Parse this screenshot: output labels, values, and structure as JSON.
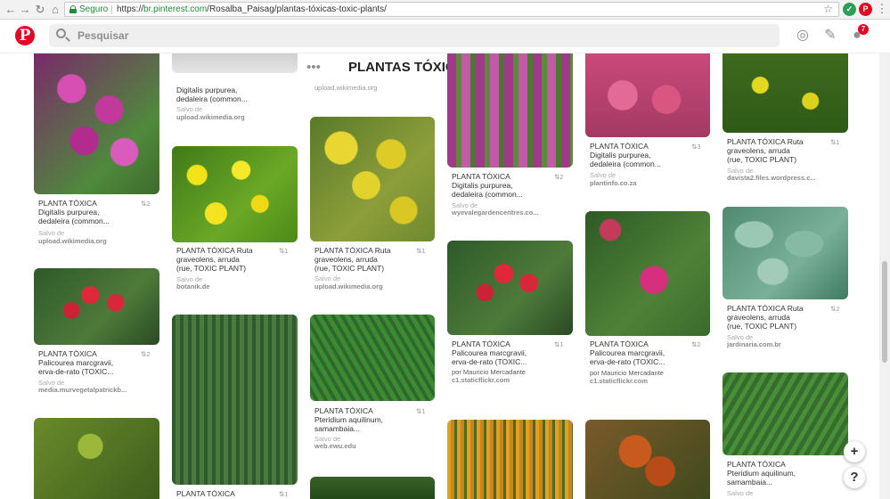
{
  "browser": {
    "secure_label": "Seguro",
    "url_scheme": "https://",
    "url_host": "br.pinterest.com",
    "url_path": "/Rosalba_Paisag/plantas-tóxicas-toxic-plants/"
  },
  "header": {
    "logo": "P",
    "search_placeholder": "Pesquisar",
    "notification_count": "7"
  },
  "board": {
    "title": "PLANTAS TÓXICAS - TOXIC ..."
  },
  "pins": [
    {
      "id": "c1a",
      "title_lines": [
        "PLANTA TÓXICA",
        "Digitalis purpurea,",
        "dedaleira (common..."
      ],
      "count": "2",
      "from": "Salvo de",
      "source": "upload.wikimedia.org"
    },
    {
      "id": "c1b",
      "title_lines": [
        "PLANTA TÓXICA",
        "Palicourea marcgravii,",
        "erva-de-rato (TOXIC..."
      ],
      "count": "2",
      "from": "Salvo de",
      "source": "media.murvegetalpatrickb..."
    },
    {
      "id": "c2a",
      "title_lines": [
        "Digitalis purpurea,",
        "dedaleira (common..."
      ],
      "count": "",
      "from": "Salvo de",
      "source": "upload.wikimedia.org"
    },
    {
      "id": "c2b",
      "title_lines": [
        "PLANTA TÓXICA Ruta",
        "graveolens, arruda",
        "(rue, TOXIC PLANT)"
      ],
      "count": "1",
      "from": "Salvo de",
      "source": "botanik.de"
    },
    {
      "id": "c2c",
      "title_lines": [
        "PLANTA TÓXICA"
      ],
      "count": "1",
      "from": "",
      "source": ""
    },
    {
      "id": "c3a",
      "title_lines": [],
      "count": "",
      "from": "",
      "source": "upload.wikimedia.org"
    },
    {
      "id": "c3b",
      "title_lines": [
        "PLANTA TÓXICA Ruta",
        "graveolens, arruda",
        "(rue, TOXIC PLANT)"
      ],
      "count": "1",
      "from": "Salvo de",
      "source": "upload.wikimedia.org"
    },
    {
      "id": "c3c",
      "title_lines": [
        "PLANTA TÓXICA",
        "Pteridium aquilinum,",
        "samambaia..."
      ],
      "count": "1",
      "from": "Salvo de",
      "source": "web.ewu.edu"
    },
    {
      "id": "c4a",
      "title_lines": [
        "PLANTA TÓXICA",
        "Digitalis purpurea,",
        "dedaleira (common..."
      ],
      "count": "2",
      "from": "Salvo de",
      "source": "wyevalegardencentres.co..."
    },
    {
      "id": "c4b",
      "title_lines": [
        "PLANTA TÓXICA",
        "Palicourea marcgravii,",
        "erva-de-rato (TOXIC..."
      ],
      "count": "1",
      "from": "por Mauricio Mercadante",
      "source": "c1.staticflickr.com"
    },
    {
      "id": "c5a",
      "title_lines": [
        "PLANTA TÓXICA",
        "Digitalis purpurea,",
        "dedaleira (common..."
      ],
      "count": "3",
      "from": "Salvo de",
      "source": "plantinfo.co.za"
    },
    {
      "id": "c5b",
      "title_lines": [
        "PLANTA TÓXICA",
        "Palicourea marcgravii,",
        "erva-de-rato (TOXIC..."
      ],
      "count": "2",
      "from": "por Mauricio Mercadante",
      "source": "c1.staticflickr.com"
    },
    {
      "id": "c6a",
      "title_lines": [
        "PLANTA TÓXICA Ruta",
        "graveolens, arruda",
        "(rue, TOXIC PLANT)"
      ],
      "count": "1",
      "from": "Salvo de",
      "source": "davista2.files.wordpress.c..."
    },
    {
      "id": "c6b",
      "title_lines": [
        "PLANTA TÓXICA Ruta",
        "graveolens, arruda",
        "(rue, TOXIC PLANT)"
      ],
      "count": "2",
      "from": "Salvo de",
      "source": "jardinaria.com.br"
    },
    {
      "id": "c6c",
      "title_lines": [
        "PLANTA TÓXICA",
        "Pteridium aquilinum,",
        "samambaia..."
      ],
      "count": "",
      "from": "Salvo de",
      "source": ""
    }
  ],
  "floating": {
    "add": "+",
    "help": "?"
  },
  "colors": {
    "brand": "#e60023",
    "secure": "#1a8c3a"
  }
}
